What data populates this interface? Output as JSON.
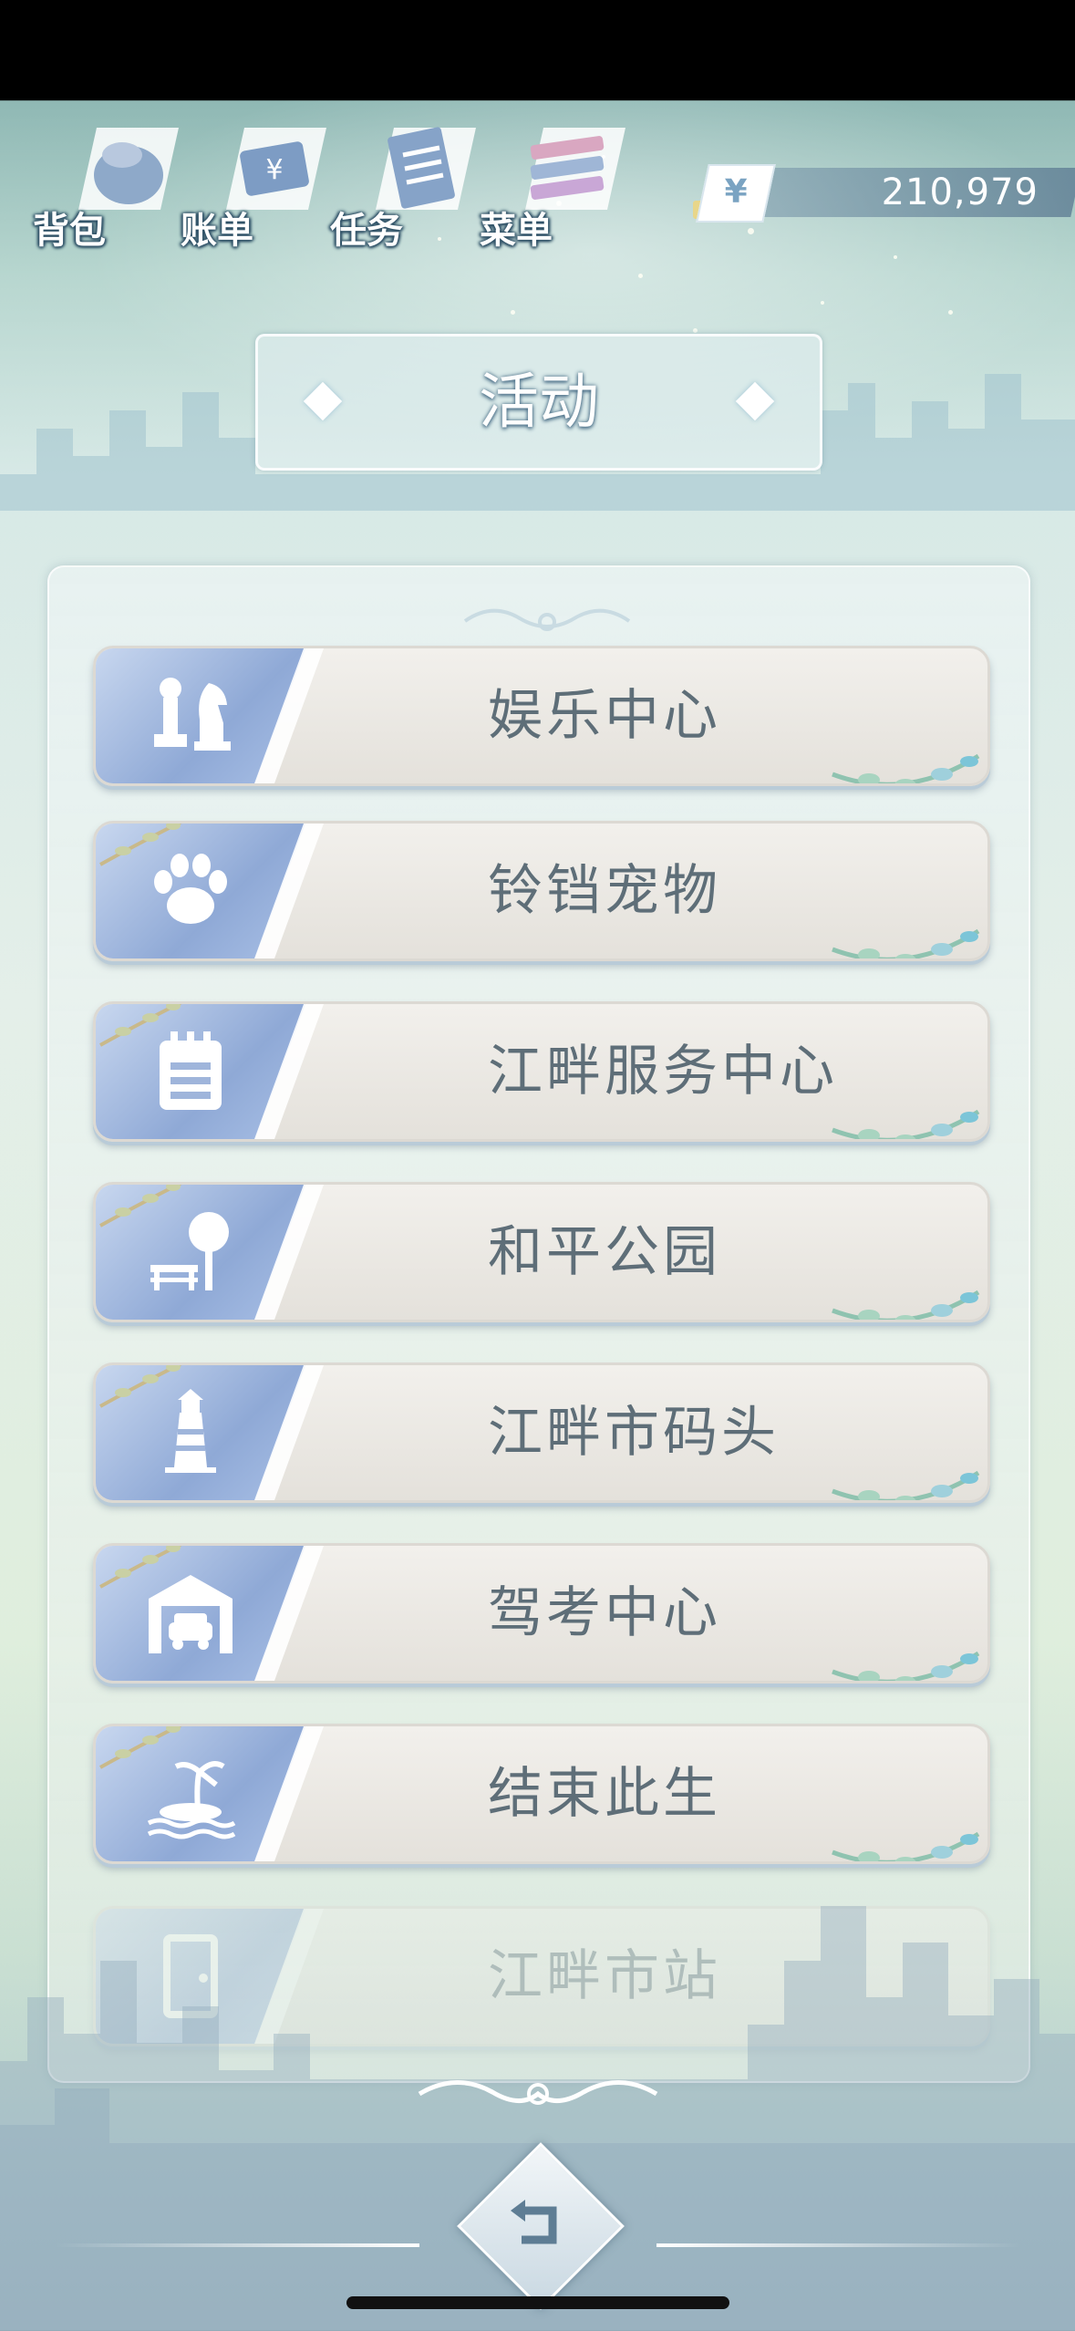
{
  "header": {
    "nav": [
      {
        "label": "背包",
        "icon": "bag-icon"
      },
      {
        "label": "账单",
        "icon": "bill-icon"
      },
      {
        "label": "任务",
        "icon": "task-icon"
      },
      {
        "label": "菜单",
        "icon": "menu-icon"
      }
    ],
    "currency": {
      "symbol": "¥",
      "value": "210,979"
    }
  },
  "title": "活动",
  "activities": [
    {
      "label": "娱乐中心",
      "icon": "chess-pieces-icon"
    },
    {
      "label": "铃铛宠物",
      "icon": "paw-icon"
    },
    {
      "label": "江畔服务中心",
      "icon": "notepad-icon"
    },
    {
      "label": "和平公园",
      "icon": "bench-tree-icon"
    },
    {
      "label": "江畔市码头",
      "icon": "lighthouse-icon"
    },
    {
      "label": "驾考中心",
      "icon": "garage-car-icon"
    },
    {
      "label": "结束此生",
      "icon": "island-palm-icon"
    },
    {
      "label": "江畔市站",
      "icon": "door-icon"
    }
  ],
  "colors": {
    "accent_blue": "#8fa9d6",
    "label_text": "#5e6e78",
    "card_bg": "#f2f0ec"
  }
}
